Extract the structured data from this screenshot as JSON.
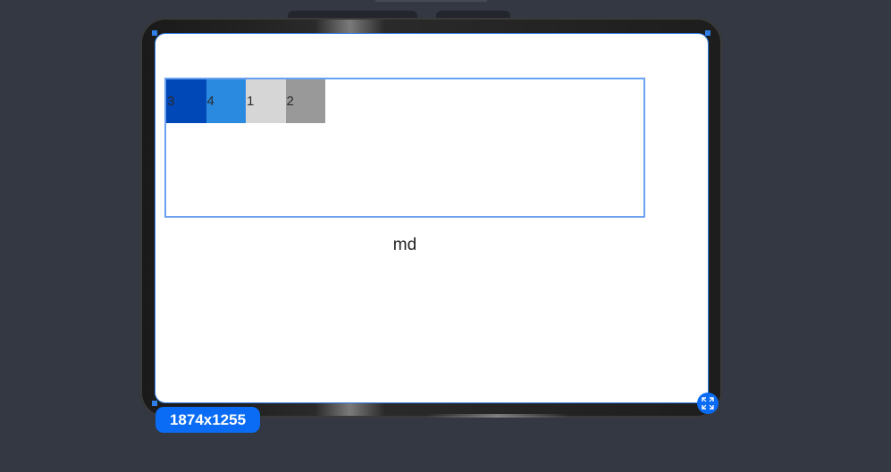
{
  "preview": {
    "breakpoint_label": "md",
    "resolution_badge": "1874x1255"
  },
  "cells": [
    {
      "label": "3",
      "color": "#0047b8"
    },
    {
      "label": "4",
      "color": "#2a8ae0"
    },
    {
      "label": "1",
      "color": "#d6d6d6"
    },
    {
      "label": "2",
      "color": "#999999"
    }
  ],
  "colors": {
    "background": "#333842",
    "accent": "#0a6cf5",
    "outline": "#6aa0f0"
  },
  "icons": {
    "expand": "expand-arrows-icon"
  }
}
